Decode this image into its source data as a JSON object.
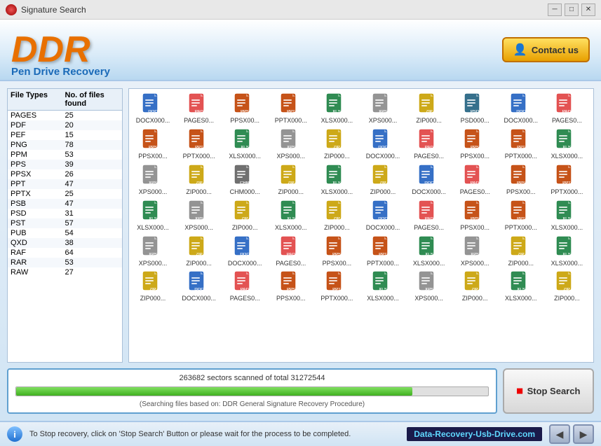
{
  "titleBar": {
    "title": "Signature Search",
    "minimizeLabel": "─",
    "maximizeLabel": "□",
    "closeLabel": "✕"
  },
  "header": {
    "logoText": "DDR",
    "subtitle": "Pen Drive Recovery",
    "contactButton": "Contact us"
  },
  "leftPanel": {
    "col1Header": "File Types",
    "col2Header": "No. of files found",
    "rows": [
      {
        "type": "PAGES",
        "count": "25"
      },
      {
        "type": "PDF",
        "count": "20"
      },
      {
        "type": "PEF",
        "count": "15"
      },
      {
        "type": "PNG",
        "count": "78"
      },
      {
        "type": "PPM",
        "count": "53"
      },
      {
        "type": "PPS",
        "count": "39"
      },
      {
        "type": "PPSX",
        "count": "26"
      },
      {
        "type": "PPT",
        "count": "47"
      },
      {
        "type": "PPTX",
        "count": "25"
      },
      {
        "type": "PSB",
        "count": "47"
      },
      {
        "type": "PSD",
        "count": "31"
      },
      {
        "type": "PST",
        "count": "57"
      },
      {
        "type": "PUB",
        "count": "54"
      },
      {
        "type": "QXD",
        "count": "38"
      },
      {
        "type": "RAF",
        "count": "64"
      },
      {
        "type": "RAR",
        "count": "53"
      },
      {
        "type": "RAW",
        "count": "27"
      }
    ]
  },
  "fileGrid": {
    "rows": [
      [
        "DOCX000...",
        "PAGES0...",
        "PPSX00...",
        "PPTX000...",
        "XLSX000...",
        "XPS000...",
        "ZIP000...",
        "PSD000...",
        "DOCX000...",
        "PAGES0..."
      ],
      [
        "PPSX00...",
        "PPTX000...",
        "XLSX000...",
        "XPS000...",
        "ZIP000...",
        "DOCX000...",
        "PAGES0...",
        "PPSX00...",
        "PPTX000...",
        "XLSX000..."
      ],
      [
        "XPS000...",
        "ZIP000...",
        "CHM000...",
        "ZIP000...",
        "XLSX000...",
        "ZIP000...",
        "DOCX000...",
        "PAGES0...",
        "PPSX00...",
        "PPTX000..."
      ],
      [
        "XLSX000...",
        "XPS000...",
        "ZIP000...",
        "XLSX000...",
        "ZIP000...",
        "DOCX000...",
        "PAGES0...",
        "PPSX00...",
        "PPTX000...",
        "XLSX000..."
      ],
      [
        "XPS000...",
        "ZIP000...",
        "DOCX000...",
        "PAGES0...",
        "PPSX00...",
        "PPTX000...",
        "XLSX000...",
        "XPS000...",
        "ZIP000...",
        "XLSX000..."
      ],
      [
        "ZIP000...",
        "DOCX000...",
        "PAGES0...",
        "PPSX00...",
        "PPTX000...",
        "XLSX000...",
        "XPS000...",
        "ZIP000...",
        "XLSX000...",
        "ZIP000..."
      ]
    ]
  },
  "progress": {
    "title": "263682 sectors scanned of total 31272544",
    "percent": 0.84,
    "subtitle": "(Searching files based on:  DDR General Signature Recovery Procedure)",
    "stopButton": "Stop Search"
  },
  "bottomBar": {
    "infoText": "To Stop recovery, click on 'Stop Search' Button or please wait for the process to be completed.",
    "brand": "Data-Recovery-Usb-Drive.com",
    "prevLabel": "◀",
    "nextLabel": "▶"
  },
  "colors": {
    "accent": "#e87000",
    "blue": "#1a6ab8",
    "progressGreen": "#40b020"
  }
}
